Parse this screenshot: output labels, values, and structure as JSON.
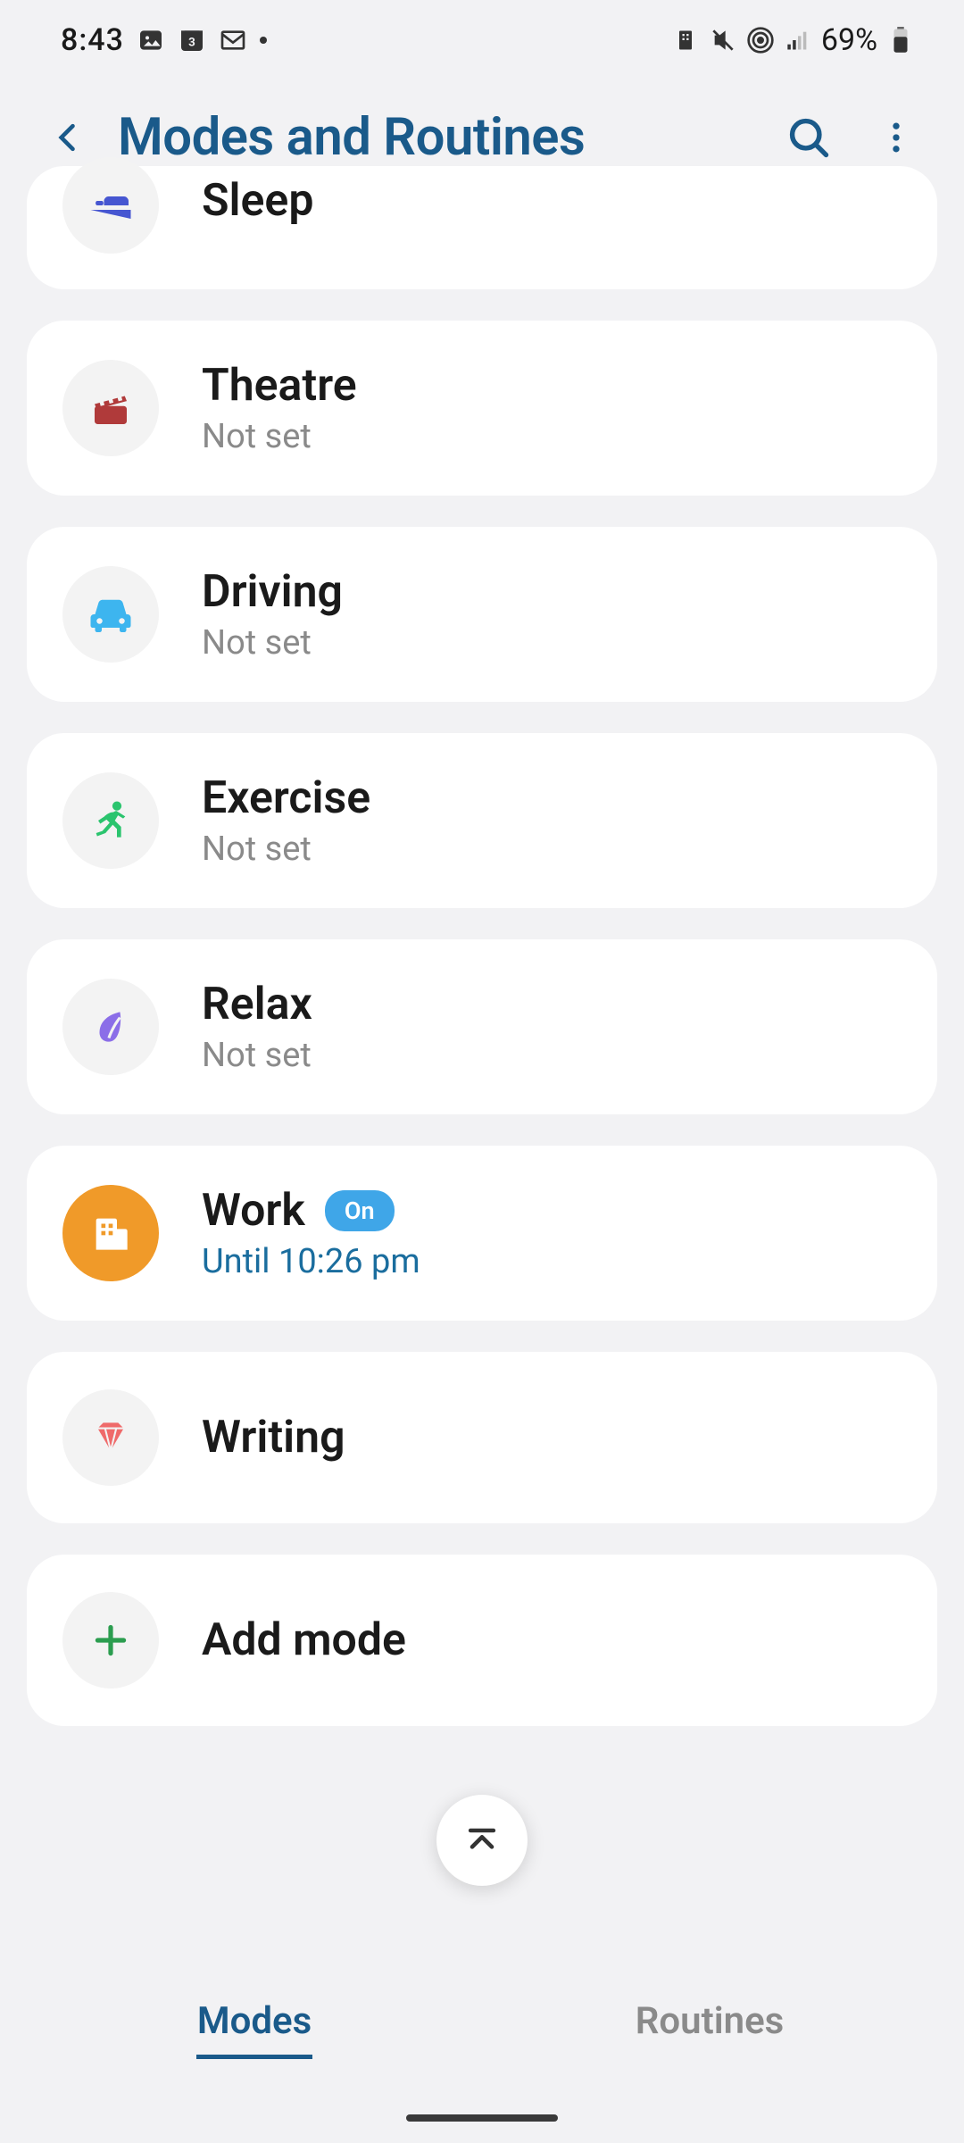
{
  "status_bar": {
    "time": "8:43",
    "battery": "69%"
  },
  "header": {
    "title": "Modes and Routines"
  },
  "modes": [
    {
      "name": "Sleep",
      "sub": "",
      "icon": "bed",
      "iconColor": "#4656d1"
    },
    {
      "name": "Theatre",
      "sub": "Not set",
      "icon": "clapper",
      "iconColor": "#b03a3a"
    },
    {
      "name": "Driving",
      "sub": "Not set",
      "icon": "car",
      "iconColor": "#3db5ef"
    },
    {
      "name": "Exercise",
      "sub": "Not set",
      "icon": "runner",
      "iconColor": "#2bc46e"
    },
    {
      "name": "Relax",
      "sub": "Not set",
      "icon": "leaf",
      "iconColor": "#8b6ee8"
    },
    {
      "name": "Work",
      "sub": "Until 10:26  pm",
      "icon": "building",
      "iconColor": "#ffffff",
      "active": true,
      "badge": "On"
    },
    {
      "name": "Writing",
      "sub": "",
      "icon": "gem",
      "iconColor": "#ef6a6a"
    },
    {
      "name": "Add mode",
      "sub": "",
      "icon": "plus",
      "iconColor": "#2b9d4f"
    }
  ],
  "bottom_nav": {
    "modes": "Modes",
    "routines": "Routines"
  }
}
